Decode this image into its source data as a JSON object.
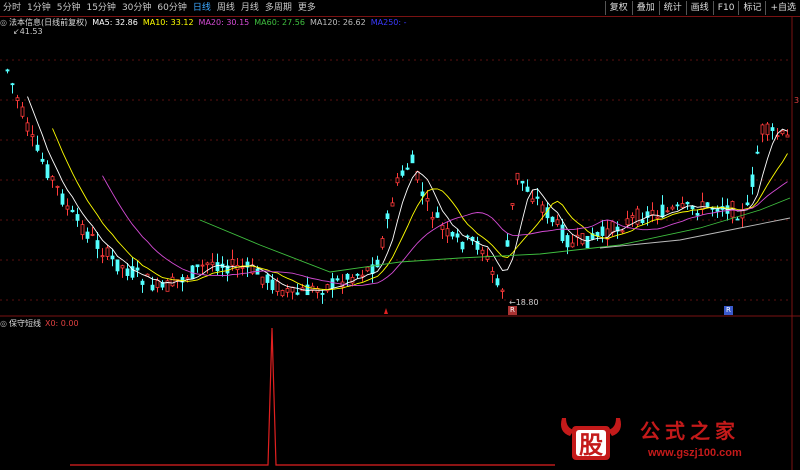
{
  "toolbar": {
    "timeframes": [
      "分时",
      "1分钟",
      "5分钟",
      "15分钟",
      "30分钟",
      "60分钟",
      "日线",
      "周线",
      "月线",
      "多周期",
      "更多"
    ],
    "active_index": 6,
    "right_buttons": [
      "复权",
      "叠加",
      "统计",
      "画线",
      "F10",
      "标记",
      "+自选"
    ]
  },
  "legend": {
    "title": "法本信息(日线前复权)",
    "ma5": "MA5: 32.86",
    "ma10": "MA10: 33.12",
    "ma20": "MA20: 30.15",
    "ma60": "MA60: 27.56",
    "ma120": "MA120: 26.62",
    "ma250": "MA250: -",
    "colors": {
      "ma5": "#ffffff",
      "ma10": "#ffff00",
      "ma20": "#d44bd4",
      "ma60": "#3fbf3f",
      "ma120": "#bbbbbb",
      "ma250": "#3a3aff"
    }
  },
  "price": {
    "max_label": "41.53",
    "min_label": "18.80",
    "right_edge": "3"
  },
  "indicator": {
    "name": "保守短线",
    "value": "X0: 0.00"
  },
  "markers": [
    "R",
    "R"
  ],
  "logo": {
    "char": "股",
    "name": "公式之家",
    "url": "www.gszj100.com"
  }
}
